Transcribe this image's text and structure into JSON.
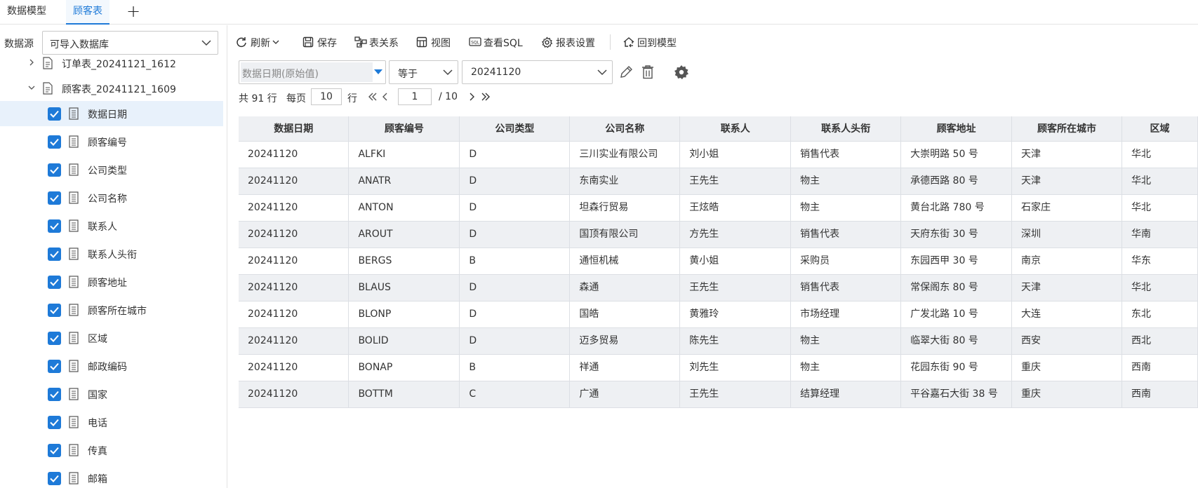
{
  "tabs": [
    {
      "label": "数据模型",
      "active": false
    },
    {
      "label": "顾客表",
      "active": true
    }
  ],
  "add_tab_icon": "plus-icon",
  "datasource": {
    "label": "数据源",
    "value": "可导入数据库"
  },
  "tree": {
    "nodes": [
      {
        "label": "订单表_20241121_1612"
      },
      {
        "label": "顾客表_20241121_1609"
      }
    ],
    "fields": [
      "数据日期",
      "顾客编号",
      "公司类型",
      "公司名称",
      "联系人",
      "联系人头衔",
      "顾客地址",
      "顾客所在城市",
      "区域",
      "邮政编码",
      "国家",
      "电话",
      "传真",
      "邮箱"
    ],
    "selected_index": 0
  },
  "toolbar": {
    "refresh": "刷新",
    "save": "保存",
    "relation": "表关系",
    "view": "视图",
    "sql": "查看SQL",
    "report": "报表设置",
    "back": "回到模型"
  },
  "filter": {
    "field_placeholder": "数据日期(原始值)",
    "operator": "等于",
    "value": "20241120"
  },
  "pager": {
    "total": "共 91 行",
    "per_page_label": "每页",
    "per_page": "10",
    "row_unit": "行",
    "page": "1",
    "pages": "/ 10"
  },
  "table": {
    "columns": [
      "数据日期",
      "顾客编号",
      "公司类型",
      "公司名称",
      "联系人",
      "联系人头衔",
      "顾客地址",
      "顾客所在城市",
      "区域"
    ],
    "rows": [
      [
        "20241120",
        "ALFKI",
        "D",
        "三川实业有限公司",
        "刘小姐",
        "销售代表",
        "大崇明路 50 号",
        "天津",
        "华北"
      ],
      [
        "20241120",
        "ANATR",
        "D",
        "东南实业",
        "王先生",
        "物主",
        "承德西路 80 号",
        "天津",
        "华北"
      ],
      [
        "20241120",
        "ANTON",
        "D",
        "坦森行贸易",
        "王炫皓",
        "物主",
        "黄台北路 780 号",
        "石家庄",
        "华北"
      ],
      [
        "20241120",
        "AROUT",
        "D",
        "国顶有限公司",
        "方先生",
        "销售代表",
        "天府东街 30 号",
        "深圳",
        "华南"
      ],
      [
        "20241120",
        "BERGS",
        "B",
        "通恒机械",
        "黄小姐",
        "采购员",
        "东园西甲 30 号",
        "南京",
        "华东"
      ],
      [
        "20241120",
        "BLAUS",
        "D",
        "森通",
        "王先生",
        "销售代表",
        "常保阁东 80 号",
        "天津",
        "华北"
      ],
      [
        "20241120",
        "BLONP",
        "D",
        "国皓",
        "黄雅玲",
        "市场经理",
        "广发北路 10 号",
        "大连",
        "东北"
      ],
      [
        "20241120",
        "BOLID",
        "D",
        "迈多贸易",
        "陈先生",
        "物主",
        "临翠大街 80 号",
        "西安",
        "西北"
      ],
      [
        "20241120",
        "BONAP",
        "B",
        "祥通",
        "刘先生",
        "物主",
        "花园东街 90 号",
        "重庆",
        "西南"
      ],
      [
        "20241120",
        "BOTTM",
        "C",
        "广通",
        "王先生",
        "结算经理",
        "平谷嘉石大街 38 号",
        "重庆",
        "西南"
      ]
    ]
  },
  "colors": {
    "accent": "#1e7ad8",
    "header_bg": "#eef0f3",
    "selected_bg": "#e8f1fb"
  }
}
